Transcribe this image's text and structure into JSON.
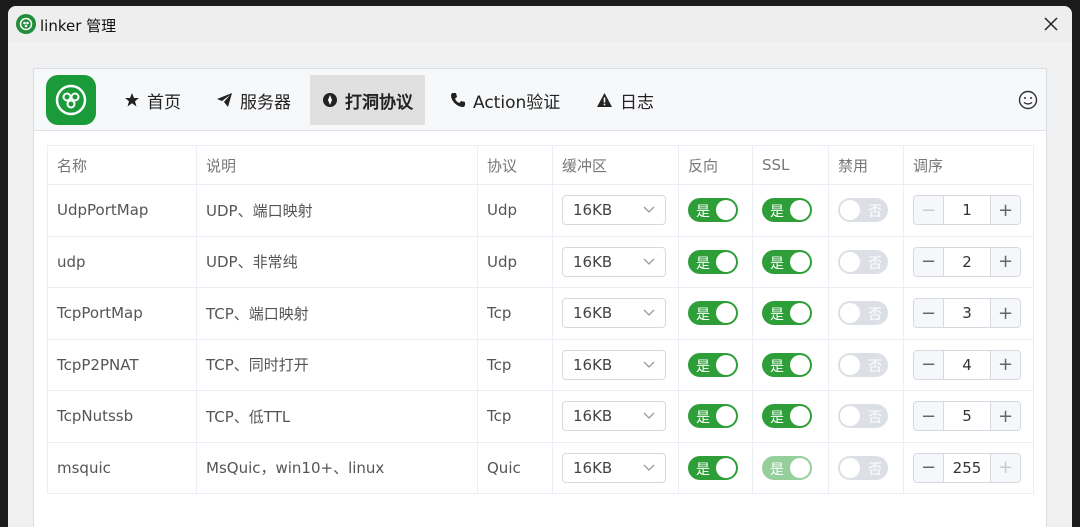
{
  "window": {
    "title": "linker 管理",
    "close_icon": "close-icon"
  },
  "nav": {
    "items": [
      {
        "label": "首页",
        "icon": "star-icon"
      },
      {
        "label": "服务器",
        "icon": "paper-plane-icon"
      },
      {
        "label": "打洞协议",
        "icon": "compass-icon",
        "active": true
      },
      {
        "label": "Action验证",
        "icon": "phone-icon"
      },
      {
        "label": "日志",
        "icon": "warning-icon"
      }
    ]
  },
  "table": {
    "headers": [
      "名称",
      "说明",
      "协议",
      "缓冲区",
      "反向",
      "SSL",
      "禁用",
      "调序"
    ],
    "rows": [
      {
        "name": "UdpPortMap",
        "desc": "UDP、端口映射",
        "proto": "Udp",
        "buffer": "16KB",
        "reverse": "是",
        "ssl": "是",
        "disabled": "否",
        "order": "1"
      },
      {
        "name": "udp",
        "desc": "UDP、非常纯",
        "proto": "Udp",
        "buffer": "16KB",
        "reverse": "是",
        "ssl": "是",
        "disabled": "否",
        "order": "2"
      },
      {
        "name": "TcpPortMap",
        "desc": "TCP、端口映射",
        "proto": "Tcp",
        "buffer": "16KB",
        "reverse": "是",
        "ssl": "是",
        "disabled": "否",
        "order": "3"
      },
      {
        "name": "TcpP2PNAT",
        "desc": "TCP、同时打开",
        "proto": "Tcp",
        "buffer": "16KB",
        "reverse": "是",
        "ssl": "是",
        "disabled": "否",
        "order": "4"
      },
      {
        "name": "TcpNutssb",
        "desc": "TCP、低TTL",
        "proto": "Tcp",
        "buffer": "16KB",
        "reverse": "是",
        "ssl": "是",
        "disabled": "否",
        "order": "5"
      },
      {
        "name": "msquic",
        "desc": "MsQuic，win10+、linux",
        "proto": "Quic",
        "buffer": "16KB",
        "reverse": "是",
        "ssl": "是",
        "disabled": "否",
        "order": "255"
      }
    ]
  },
  "colors": {
    "switch_on": "#2e9e39",
    "switch_on_disabled": "#95cf9b",
    "switch_off": "#dcdfe6",
    "logo": "#1a9a38"
  }
}
